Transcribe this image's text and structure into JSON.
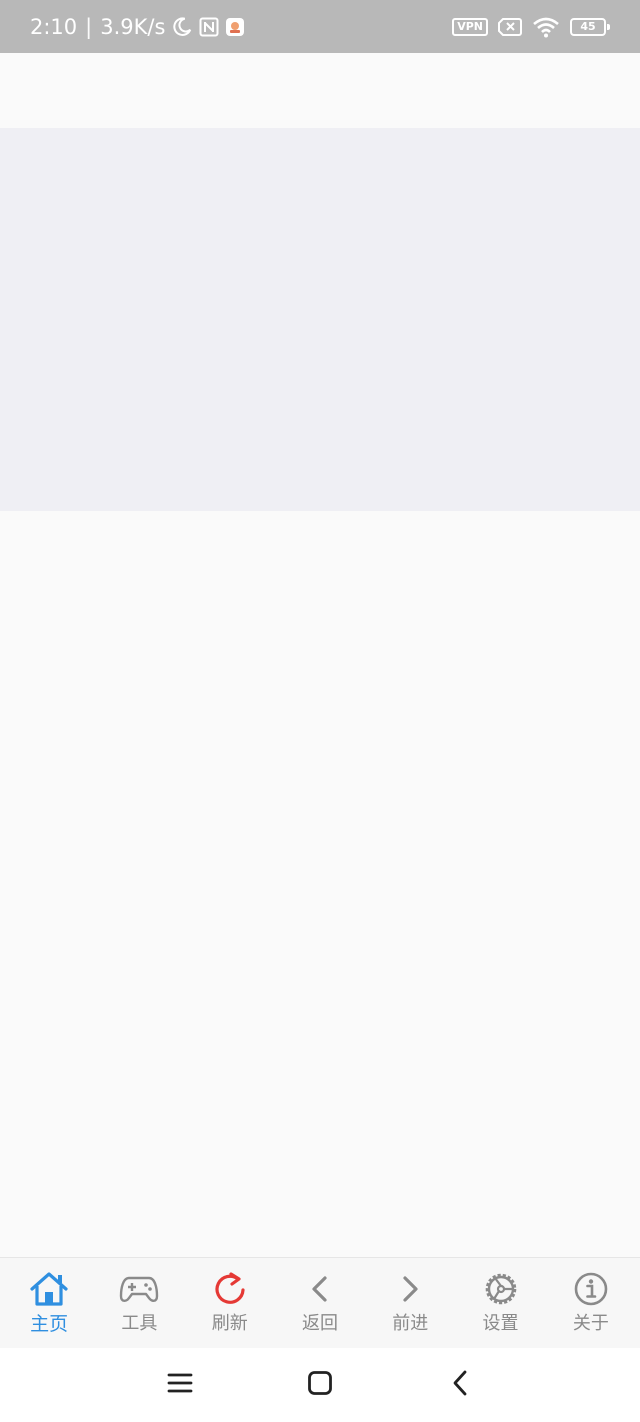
{
  "status_bar": {
    "time": "2:10",
    "separator": "|",
    "net_speed": "3.9K/s",
    "vpn": "VPN",
    "battery": "45",
    "icons": [
      "moon-icon",
      "nfc-icon",
      "app-notification-icon",
      "vpn-icon",
      "no-sim-icon",
      "wifi-icon",
      "battery-icon"
    ]
  },
  "toolbar": {
    "items": [
      {
        "label": "主页",
        "icon": "home-icon",
        "active": true,
        "color": "#2f8fe0"
      },
      {
        "label": "工具",
        "icon": "gamepad-icon",
        "active": false
      },
      {
        "label": "刷新",
        "icon": "refresh-icon",
        "active": false,
        "color": "#e53935"
      },
      {
        "label": "返回",
        "icon": "chevron-left-icon",
        "active": false
      },
      {
        "label": "前进",
        "icon": "chevron-right-icon",
        "active": false
      },
      {
        "label": "设置",
        "icon": "settings-gear-icon",
        "active": false
      },
      {
        "label": "关于",
        "icon": "info-icon",
        "active": false
      }
    ]
  },
  "nav_bar": {
    "buttons": [
      "menu-icon",
      "home-square-icon",
      "back-icon"
    ]
  },
  "colors": {
    "status_bar_bg": "#b8b8b8",
    "banner_bg": "#efeff4",
    "page_bg": "#fafafa",
    "accent": "#2f8fe0",
    "refresh": "#e53935",
    "inactive": "#8a8a8a"
  }
}
